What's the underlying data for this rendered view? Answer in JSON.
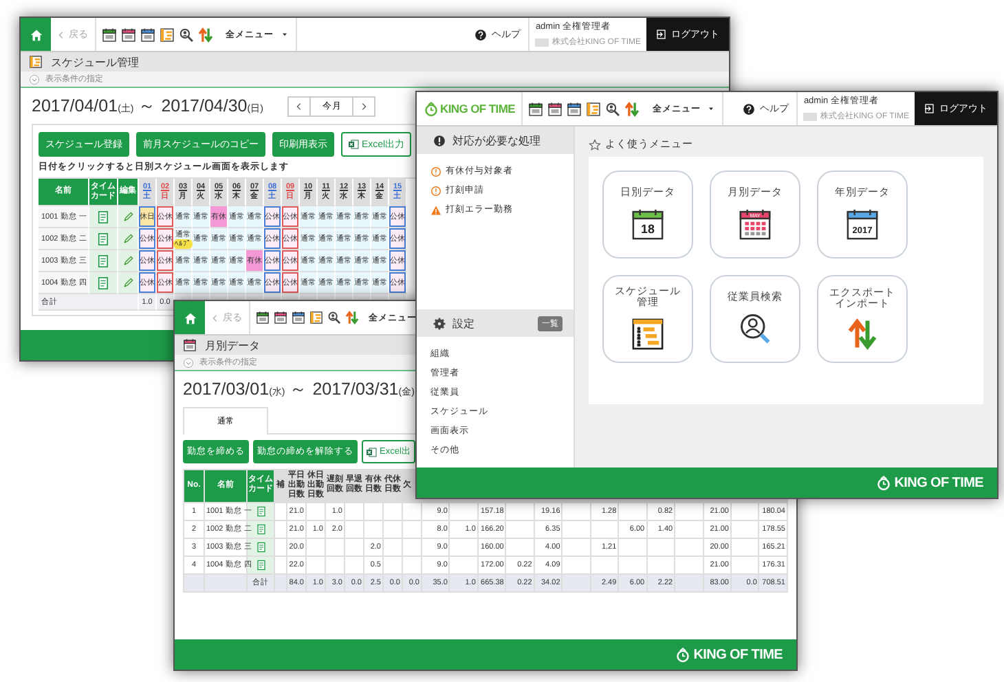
{
  "schedule_window": {
    "header": {
      "back": "戻る",
      "menu": "全メニュー",
      "help": "ヘルプ",
      "user": "admin 全権管理者",
      "company": "株式会社KING OF TIME",
      "logout": "ログアウト"
    },
    "title": "スケジュール管理",
    "filter": "表示条件の指定",
    "period": {
      "start": "2017/04/01",
      "start_weekday": "(土)",
      "separator": "～",
      "end": "2017/04/30",
      "end_weekday": "(日)"
    },
    "month_nav": "今月",
    "buttons": [
      {
        "label": "スケジュール登録",
        "kind": "primary"
      },
      {
        "label": "前月スケジュールのコピー",
        "kind": "primary"
      },
      {
        "label": "印刷用表示",
        "kind": "primary"
      },
      {
        "label": "Excel出力",
        "kind": "excel"
      }
    ],
    "hint": "日付をクリックすると日別スケジュール画面を表示します",
    "table": {
      "columns": [
        "名前",
        "タイムカード",
        "編集"
      ],
      "dates": [
        {
          "day": "01",
          "weekday": "土",
          "kind": "saturday"
        },
        {
          "day": "02",
          "weekday": "日",
          "kind": "sunday"
        },
        {
          "day": "03",
          "weekday": "月",
          "kind": "weekday"
        },
        {
          "day": "04",
          "weekday": "火",
          "kind": "weekday"
        },
        {
          "day": "05",
          "weekday": "水",
          "kind": "weekday"
        },
        {
          "day": "06",
          "weekday": "木",
          "kind": "weekday"
        },
        {
          "day": "07",
          "weekday": "金",
          "kind": "weekday"
        },
        {
          "day": "08",
          "weekday": "土",
          "kind": "saturday"
        },
        {
          "day": "09",
          "weekday": "日",
          "kind": "sunday"
        },
        {
          "day": "10",
          "weekday": "月",
          "kind": "weekday"
        },
        {
          "day": "11",
          "weekday": "火",
          "kind": "weekday"
        },
        {
          "day": "12",
          "weekday": "水",
          "kind": "weekday"
        },
        {
          "day": "13",
          "weekday": "木",
          "kind": "weekday"
        },
        {
          "day": "14",
          "weekday": "金",
          "kind": "weekday"
        },
        {
          "day": "15",
          "weekday": "土",
          "kind": "saturday"
        }
      ],
      "rows": [
        {
          "name": "1001 勤怠 一",
          "cells": [
            {
              "text": "休日",
              "kind": "day_off"
            },
            {
              "text": "公休",
              "kind": "holiday"
            },
            {
              "text": "通常",
              "kind": "regular"
            },
            {
              "text": "通常",
              "kind": "regular"
            },
            {
              "text": "有休",
              "kind": "leave"
            },
            {
              "text": "通常",
              "kind": "regular"
            },
            {
              "text": "通常",
              "kind": "regular"
            },
            {
              "text": "公休",
              "kind": "holiday"
            },
            {
              "text": "公休",
              "kind": "holiday"
            },
            {
              "text": "通常",
              "kind": "regular"
            },
            {
              "text": "通常",
              "kind": "regular"
            },
            {
              "text": "通常",
              "kind": "regular"
            },
            {
              "text": "通常",
              "kind": "regular"
            },
            {
              "text": "通常",
              "kind": "regular"
            },
            {
              "text": "公休",
              "kind": "holiday"
            }
          ]
        },
        {
          "name": "1002 勤怠 二",
          "cells": [
            {
              "text": "公休",
              "kind": "holiday"
            },
            {
              "text": "公休",
              "kind": "holiday"
            },
            {
              "text": "通常",
              "kind": "regular",
              "badge": "ﾍﾙﾌﾟ"
            },
            {
              "text": "通常",
              "kind": "regular"
            },
            {
              "text": "通常",
              "kind": "regular"
            },
            {
              "text": "通常",
              "kind": "regular"
            },
            {
              "text": "通常",
              "kind": "regular"
            },
            {
              "text": "公休",
              "kind": "holiday"
            },
            {
              "text": "公休",
              "kind": "holiday"
            },
            {
              "text": "通常",
              "kind": "regular"
            },
            {
              "text": "通常",
              "kind": "regular"
            },
            {
              "text": "通常",
              "kind": "regular"
            },
            {
              "text": "通常",
              "kind": "regular"
            },
            {
              "text": "通常",
              "kind": "regular"
            },
            {
              "text": "公休",
              "kind": "holiday"
            }
          ]
        },
        {
          "name": "1003 勤怠 三",
          "cells": [
            {
              "text": "公休",
              "kind": "holiday"
            },
            {
              "text": "公休",
              "kind": "holiday"
            },
            {
              "text": "通常",
              "kind": "regular"
            },
            {
              "text": "通常",
              "kind": "regular"
            },
            {
              "text": "通常",
              "kind": "regular"
            },
            {
              "text": "通常",
              "kind": "regular"
            },
            {
              "text": "有休",
              "kind": "leave"
            },
            {
              "text": "公休",
              "kind": "holiday"
            },
            {
              "text": "公休",
              "kind": "holiday"
            },
            {
              "text": "通常",
              "kind": "regular"
            },
            {
              "text": "通常",
              "kind": "regular"
            },
            {
              "text": "通常",
              "kind": "regular"
            },
            {
              "text": "通常",
              "kind": "regular"
            },
            {
              "text": "通常",
              "kind": "regular"
            },
            {
              "text": "公休",
              "kind": "holiday"
            }
          ]
        },
        {
          "name": "1004 勤怠 四",
          "cells": [
            {
              "text": "公休",
              "kind": "holiday"
            },
            {
              "text": "公休",
              "kind": "holiday"
            },
            {
              "text": "通常",
              "kind": "regular"
            },
            {
              "text": "通常",
              "kind": "regular"
            },
            {
              "text": "通常",
              "kind": "regular"
            },
            {
              "text": "通常",
              "kind": "regular"
            },
            {
              "text": "通常",
              "kind": "regular"
            },
            {
              "text": "公休",
              "kind": "holiday"
            },
            {
              "text": "公休",
              "kind": "holiday"
            },
            {
              "text": "通常",
              "kind": "regular"
            },
            {
              "text": "通常",
              "kind": "regular"
            },
            {
              "text": "通常",
              "kind": "regular"
            },
            {
              "text": "通常",
              "kind": "regular"
            },
            {
              "text": "通常",
              "kind": "regular"
            },
            {
              "text": "公休",
              "kind": "holiday"
            }
          ]
        }
      ],
      "total": {
        "label": "合計",
        "values": [
          "1.0",
          "0.0"
        ]
      }
    }
  },
  "monthly_window": {
    "header": {
      "back": "戻る",
      "menu": "全メニュー"
    },
    "title": "月別データ",
    "filter": "表示条件の指定",
    "period": {
      "start": "2017/03/01",
      "start_weekday": "(水)",
      "separator": "～",
      "end": "2017/03/31",
      "end_weekday": "(金)"
    },
    "tabs": [
      {
        "label": "通常",
        "selected": true
      }
    ],
    "buttons": [
      {
        "label": "勤怠を締める",
        "kind": "primary"
      },
      {
        "label": "勤怠の締めを解除する",
        "kind": "primary"
      },
      {
        "label": "Excel出",
        "kind": "excel"
      }
    ],
    "table": {
      "columns": [
        "No.",
        "名前",
        "タイムカード",
        "補",
        "平日出勤日数",
        "休日出勤日数",
        "遅刻回数",
        "早退回数",
        "有休日数",
        "代休日数",
        "欠"
      ],
      "rows": [
        {
          "no": "1",
          "name": "1001 勤怠 一",
          "values": {
            "column_5": "21.0",
            "column_7": "1.0",
            "column_12": "9.0",
            "column_14": "157.18",
            "column_16": "19.16",
            "column_18": "1.28",
            "column_20": "0.82",
            "column_22": "21.00",
            "column_24": "180.04"
          }
        },
        {
          "no": "2",
          "name": "1002 勤怠 二",
          "values": {
            "column_5": "21.0",
            "column_6": "1.0",
            "column_7": "2.0",
            "column_12": "8.0",
            "column_13": "1.0",
            "column_14": "166.20",
            "column_16": "6.35",
            "column_19": "6.00",
            "column_20": "1.40",
            "column_22": "21.00",
            "column_24": "178.55"
          }
        },
        {
          "no": "3",
          "name": "1003 勤怠 三",
          "values": {
            "column_5": "20.0",
            "column_9": "2.0",
            "column_12": "9.0",
            "column_14": "160.00",
            "column_16": "4.00",
            "column_18": "1.21",
            "column_22": "20.00",
            "column_24": "165.21"
          }
        },
        {
          "no": "4",
          "name": "1004 勤怠 四",
          "values": {
            "column_5": "22.0",
            "column_9": "0.5",
            "column_12": "9.0",
            "column_14": "172.00",
            "column_15": "0.22",
            "column_16": "4.09",
            "column_22": "21.00",
            "column_24": "176.31"
          }
        }
      ],
      "total": {
        "label": "合計",
        "values": {
          "column_5": "84.0",
          "column_6": "1.0",
          "column_7": "3.0",
          "column_8": "0.0",
          "column_9": "2.5",
          "column_10": "0.0",
          "column_11": "0.0",
          "column_12": "35.0",
          "column_13": "1.0",
          "column_14": "665.38",
          "column_15": "0.22",
          "column_16": "34.02",
          "column_18": "2.49",
          "column_19": "6.00",
          "column_20": "2.22",
          "column_22": "83.00",
          "column_23": "0.0",
          "column_24": "708.51"
        }
      }
    },
    "footer_logo": "KING OF TIME"
  },
  "home_window": {
    "header": {
      "logo": "KING OF TIME",
      "menu": "全メニュー",
      "help": "ヘルプ",
      "user": "admin 全権管理者",
      "company": "株式会社KING OF TIME",
      "logout": "ログアウト"
    },
    "todo": {
      "title": "対応が必要な処理",
      "items": [
        {
          "label": "有休付与対象者",
          "kind": "info"
        },
        {
          "label": "打刻申請",
          "kind": "info"
        },
        {
          "label": "打刻エラー勤務",
          "kind": "warning"
        }
      ]
    },
    "settings": {
      "title": "設定",
      "badge": "一覧",
      "items": [
        "組織",
        "管理者",
        "従業員",
        "スケジュール",
        "画面表示",
        "その他"
      ]
    },
    "favorites": {
      "title": "よく使うメニュー",
      "tiles": [
        {
          "label": "日別データ",
          "kind": "daily",
          "icon_text": "18"
        },
        {
          "label": "月別データ",
          "kind": "monthly",
          "icon_text": "MAY"
        },
        {
          "label": "年別データ",
          "kind": "yearly",
          "icon_text": "2017"
        },
        {
          "label": "スケジュール管理",
          "kind": "schedule"
        },
        {
          "label": "従業員検索",
          "kind": "search"
        },
        {
          "label": "エクスポートインポート",
          "kind": "transfer"
        }
      ]
    },
    "footer_logo": "KING OF TIME"
  }
}
